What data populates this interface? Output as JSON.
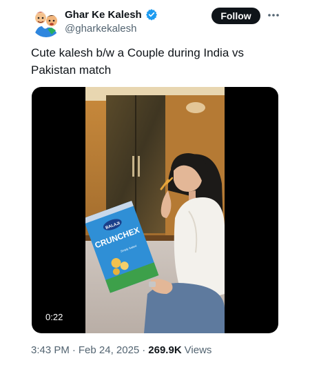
{
  "author": {
    "name": "Ghar Ke Kalesh",
    "handle": "@gharkekalesh",
    "verified": true
  },
  "actions": {
    "follow_label": "Follow",
    "more_icon": "more-horizontal-icon"
  },
  "tweet": {
    "text": "Cute kalesh b/w a Couple during India vs Pakistan match"
  },
  "media": {
    "type": "video",
    "duration": "0:22",
    "snack_bag": {
      "brand": "BALAJI",
      "product": "CRUNCHEX",
      "tag": "Simply Salted"
    }
  },
  "meta": {
    "time": "3:43 PM",
    "date": "Feb 24, 2025",
    "separator": "·",
    "views_count": "269.9K",
    "views_label": "Views"
  },
  "colors": {
    "text": "#0f1419",
    "secondary": "#536471",
    "verified_badge": "#1d9bf0",
    "follow_bg": "#0f1419"
  }
}
